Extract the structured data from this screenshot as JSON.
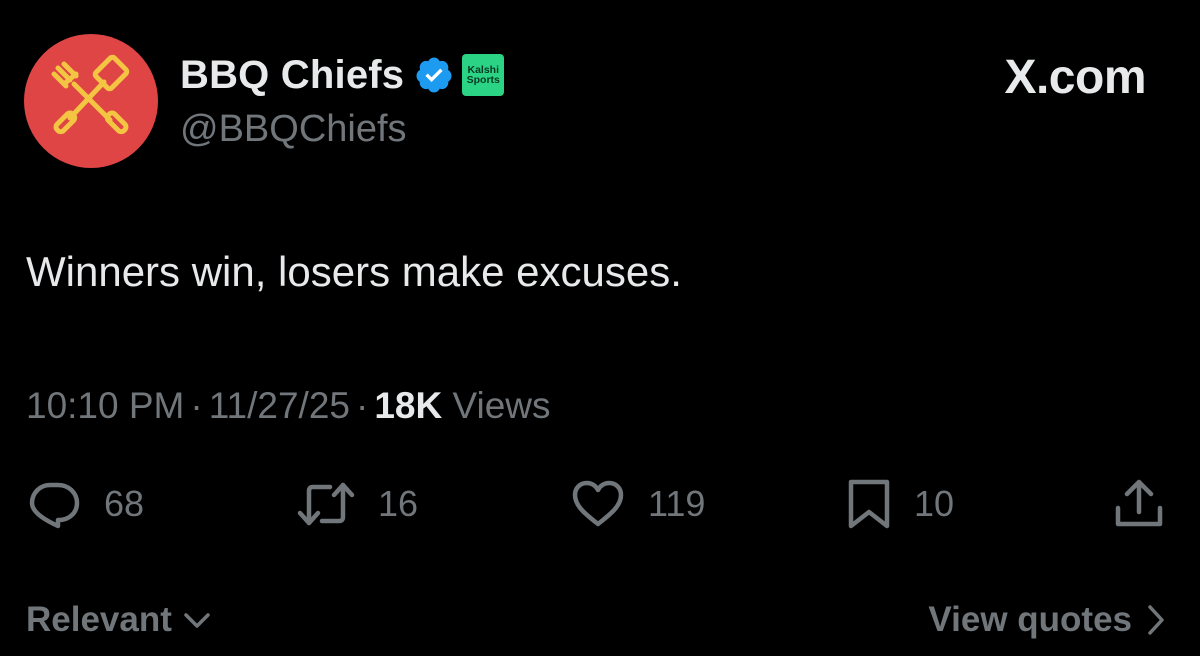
{
  "header": {
    "display_name": "BBQ Chiefs",
    "handle": "@BBQChiefs",
    "affiliate_line1": "Kalshi",
    "affiliate_line2": "Sports",
    "brand": "X.com"
  },
  "tweet": {
    "text": "Winners win, losers make excuses.",
    "time": "10:10 PM",
    "date": "11/27/25",
    "separator": "·",
    "views_count": "18K",
    "views_label": "Views"
  },
  "actions": {
    "replies": "68",
    "reposts": "16",
    "likes": "119",
    "bookmarks": "10"
  },
  "footer": {
    "sort_label": "Relevant",
    "view_quotes_label": "View quotes"
  },
  "colors": {
    "background": "#000000",
    "text_primary": "#e7e9ea",
    "text_secondary": "#71767b",
    "avatar_bg": "#df4545",
    "avatar_icon": "#f4c542",
    "verified_blue": "#1d9bf0",
    "affiliate_green": "#2bd384"
  },
  "icons": [
    "bbq-utensils-logo-icon",
    "verified-badge-icon",
    "reply-icon",
    "repost-icon",
    "like-icon",
    "bookmark-icon",
    "share-icon",
    "chevron-down-icon",
    "chevron-right-icon"
  ]
}
